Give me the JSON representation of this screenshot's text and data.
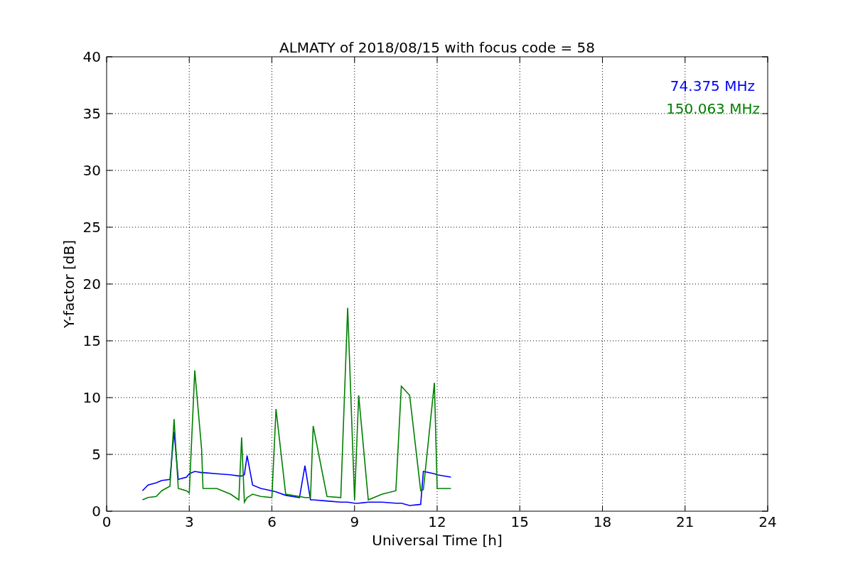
{
  "chart_data": {
    "type": "line",
    "title": "ALMATY of 2018/08/15 with focus code = 58",
    "xlabel": "Universal Time [h]",
    "ylabel": "Y-factor [dB]",
    "x": [
      1.3,
      1.5,
      1.8,
      2.0,
      2.3,
      2.45,
      2.6,
      2.9,
      3.0,
      3.2,
      3.45,
      3.5,
      4.0,
      4.5,
      4.8,
      4.9,
      5.0,
      5.1,
      5.3,
      5.6,
      6.0,
      6.15,
      6.5,
      7.0,
      7.2,
      7.4,
      7.5,
      8.0,
      8.5,
      8.75,
      9.0,
      9.15,
      9.5,
      10.0,
      10.5,
      10.7,
      11.0,
      11.4,
      11.5,
      11.9,
      12.0,
      12.5
    ],
    "series": [
      {
        "name": "74.375 MHz",
        "color": "#0000ff",
        "values": [
          1.8,
          2.3,
          2.5,
          2.7,
          2.8,
          7.0,
          2.8,
          3.0,
          3.3,
          3.5,
          3.4,
          3.4,
          3.3,
          3.2,
          3.1,
          3.1,
          3.2,
          4.9,
          2.3,
          2.0,
          1.8,
          1.7,
          1.4,
          1.2,
          4.0,
          1.0,
          1.0,
          0.9,
          0.8,
          0.8,
          0.7,
          0.7,
          0.8,
          0.8,
          0.7,
          0.7,
          0.5,
          0.6,
          3.5,
          3.3,
          3.2,
          3.0
        ]
      },
      {
        "name": "150.063 MHz",
        "color": "#008000",
        "values": [
          1.0,
          1.2,
          1.3,
          1.8,
          2.2,
          8.1,
          2.0,
          1.8,
          1.6,
          12.4,
          5.4,
          2.0,
          2.0,
          1.5,
          1.0,
          6.5,
          0.8,
          1.2,
          1.5,
          1.3,
          1.2,
          9.0,
          1.5,
          1.3,
          1.2,
          1.2,
          7.5,
          1.3,
          1.2,
          17.9,
          1.0,
          10.2,
          1.0,
          1.5,
          1.8,
          11.0,
          10.2,
          1.8,
          1.9,
          11.3,
          2.0,
          2.0
        ]
      }
    ],
    "xlim": [
      0,
      24
    ],
    "ylim": [
      0,
      40
    ],
    "xticks": [
      0,
      3,
      6,
      9,
      12,
      15,
      18,
      21,
      24
    ],
    "yticks": [
      0,
      5,
      10,
      15,
      20,
      25,
      30,
      35,
      40
    ],
    "grid": true
  }
}
